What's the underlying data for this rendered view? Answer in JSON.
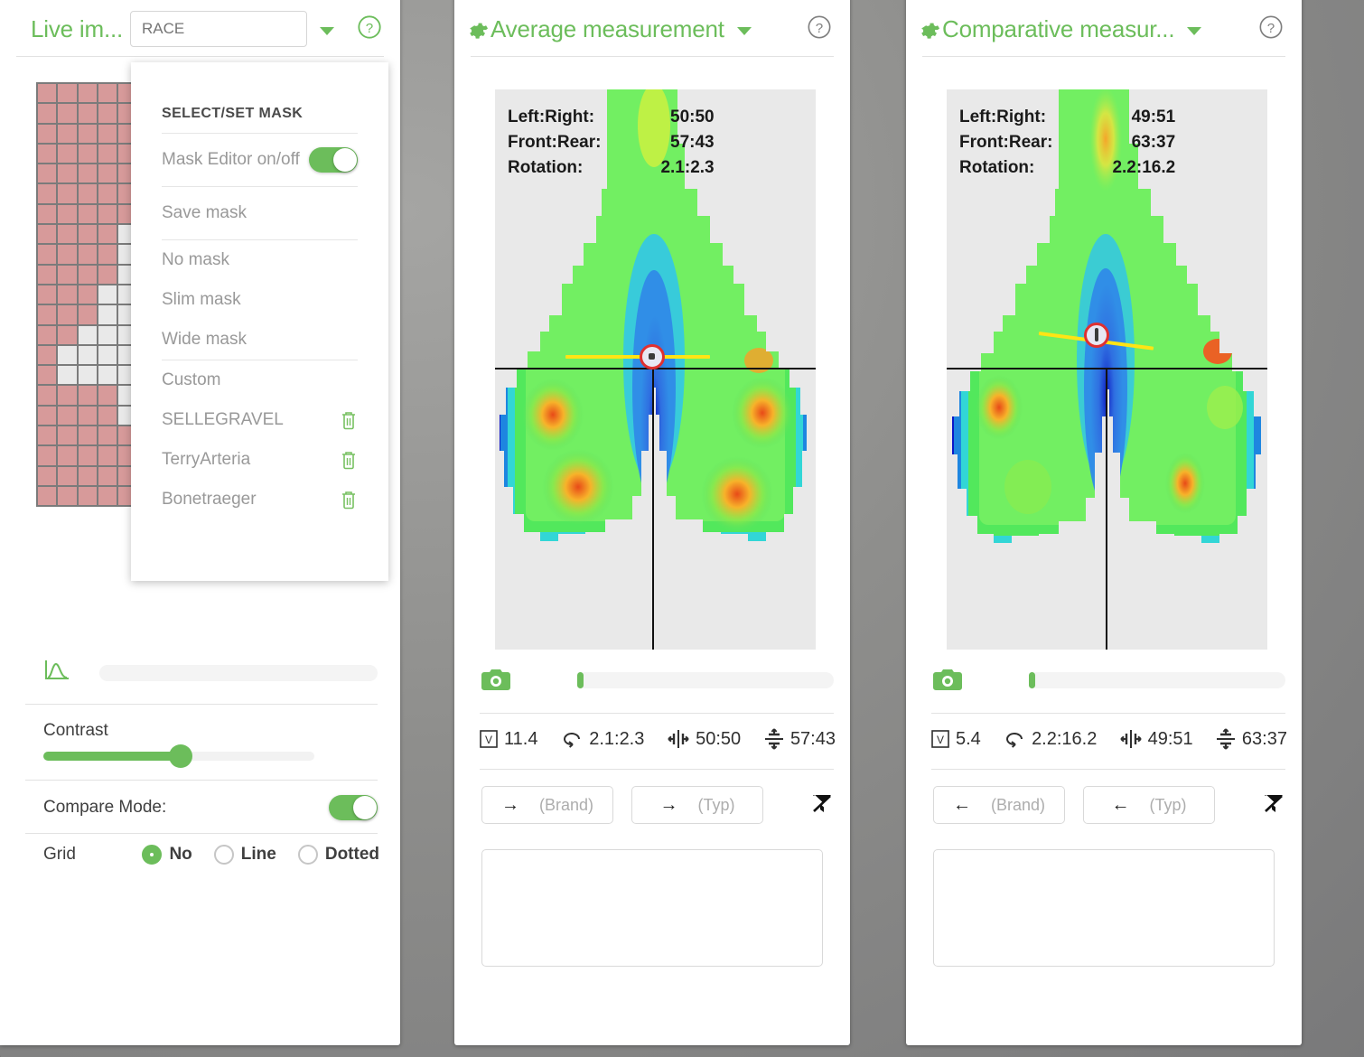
{
  "live_panel": {
    "title": "Live im...",
    "race_input_value": "",
    "race_input_placeholder": "RACE",
    "caret_icon": "chevron-down-icon",
    "help_icon": "help-circle-icon",
    "histogram_icon": "histogram-icon",
    "controls": {
      "contrast_label": "Contrast",
      "contrast_percent": 42,
      "compare_mode_label": "Compare Mode:",
      "compare_mode_on": true,
      "grid_label": "Grid",
      "grid_options": [
        "No",
        "Line",
        "Dotted"
      ],
      "grid_selected": "No"
    },
    "mask_grid": {
      "cols": 16,
      "rows": 18,
      "on_color": "#d79a9a",
      "off_color": "#e9e9e9",
      "border_color": "#7b7b7b",
      "pattern": [
        "1111100000000000",
        "1111100000000000",
        "1111100000000000",
        "1111100000000000",
        "1111100000000000",
        "1111100000000000",
        "1111100000000000",
        "1111200000000000",
        "1111200000000000",
        "1111200000000000",
        "1112200000000000",
        "1112200000000000",
        "1122200000000000",
        "1222200000000000",
        "1222200000000000",
        "1111200000000000",
        "1111200000000000",
        "1111100000000000",
        "1111111111111111",
        "1111111111111111",
        "1111111111111111"
      ]
    },
    "mask_menu": {
      "title": "SELECT/SET MASK",
      "editor_label": "Mask Editor on/off",
      "editor_on": true,
      "save_label": "Save mask",
      "presets": [
        "No mask",
        "Slim mask",
        "Wide mask"
      ],
      "custom_label": "Custom",
      "custom_masks": [
        "SELLEGRAVEL",
        "TerryArteria",
        "Bonetraeger"
      ],
      "delete_icon": "trash-icon"
    }
  },
  "average_panel": {
    "title": "Average measurement",
    "gear_icon": "gear-icon",
    "caret_icon": "chevron-down-icon",
    "help_icon": "help-circle-icon",
    "overlay_stats": [
      {
        "label": "Left:Right:",
        "value": "50:50"
      },
      {
        "label": "Front:Rear:",
        "value": "57:43"
      },
      {
        "label": "Rotation:",
        "value": "2.1:2.3"
      }
    ],
    "camera_icon": "camera-icon",
    "capture_slider_percent": 0,
    "metrics": [
      {
        "icon": "max-pressure-icon",
        "value": "11.4"
      },
      {
        "icon": "rotation-icon",
        "value": "2.1:2.3"
      },
      {
        "icon": "left-right-balance-icon",
        "value": "50:50"
      },
      {
        "icon": "front-rear-balance-icon",
        "value": "57:43"
      }
    ],
    "nav": {
      "brand_arrow": "→",
      "brand_placeholder": "(Brand)",
      "type_arrow": "→",
      "type_placeholder": "(Typ)",
      "clear_filter_icon": "clear-filter-icon"
    },
    "notes_value": "",
    "notes_placeholder": ""
  },
  "comparative_panel": {
    "title": "Comparative measur...",
    "gear_icon": "gear-icon",
    "caret_icon": "chevron-down-icon",
    "help_icon": "help-circle-icon",
    "overlay_stats": [
      {
        "label": "Left:Right:",
        "value": "49:51"
      },
      {
        "label": "Front:Rear:",
        "value": "63:37"
      },
      {
        "label": "Rotation:",
        "value": "2.2:16.2"
      }
    ],
    "camera_icon": "camera-icon",
    "capture_slider_percent": 0,
    "metrics": [
      {
        "icon": "max-pressure-icon",
        "value": "5.4"
      },
      {
        "icon": "rotation-icon",
        "value": "2.2:16.2"
      },
      {
        "icon": "left-right-balance-icon",
        "value": "49:51"
      },
      {
        "icon": "front-rear-balance-icon",
        "value": "63:37"
      }
    ],
    "nav": {
      "brand_arrow": "←",
      "brand_placeholder": "(Brand)",
      "type_arrow": "←",
      "type_placeholder": "(Typ)",
      "clear_filter_icon": "clear-filter-icon"
    },
    "notes_value": "",
    "notes_placeholder": ""
  },
  "theme": {
    "accent_green": "#6cbd5b",
    "mask_pink": "#d79a9a",
    "heat_background": "#e9e9e9",
    "cop_marker": "#e03030",
    "axis_line": "#ffe414"
  }
}
